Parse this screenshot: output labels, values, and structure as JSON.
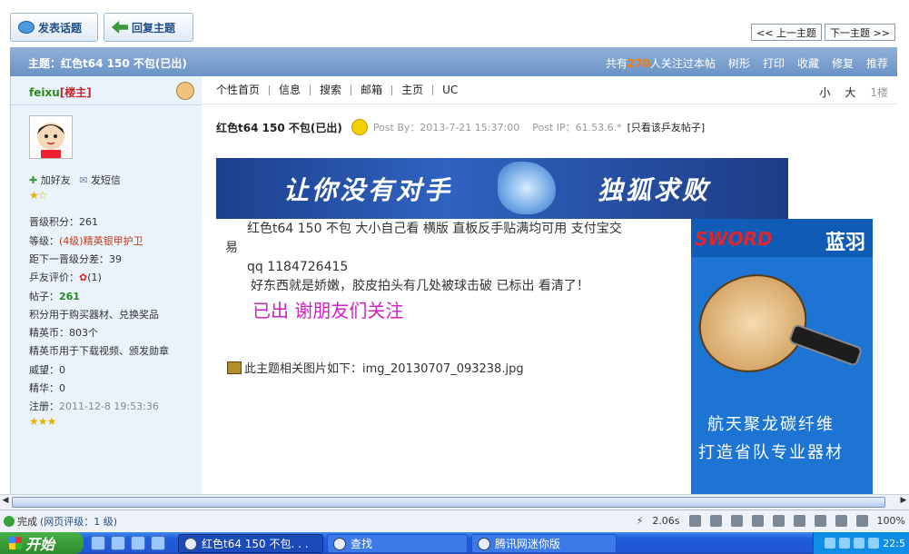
{
  "top_buttons": {
    "post_topic": "发表话题",
    "reply_topic": "回复主题",
    "prev_topic": "<< 上一主题",
    "next_topic": "下一主题 >>"
  },
  "header": {
    "title": "主题：红色t64 150 不包(已出)",
    "watch_prefix": "共有",
    "watch_count": "270",
    "watch_suffix": "人关注过本帖",
    "tools": [
      "树形",
      "打印",
      "收藏",
      "修复",
      "推荐"
    ]
  },
  "author": {
    "name": "feixu",
    "owner_tag": "[楼主]",
    "add_friend": "加好友",
    "send_message": "发短信",
    "rank_stars": "★☆",
    "points_label": "晋级积分：",
    "points_value": "261",
    "level_label": "等级：",
    "level_value": "(4级)精英银甲护卫",
    "next_label": "距下一晋级分差：",
    "next_value": "39",
    "rating_label": "乒友评价：",
    "rating_value": "(1)",
    "posts_label": "帖子：",
    "posts_value": "261",
    "posts_note": "积分用于购买器材、兑换奖品",
    "coins_label": "精英币：",
    "coins_value": "803个",
    "coins_note": "精英币用于下载视频、颁发勋章",
    "prestige_label": "威望：",
    "prestige_value": "0",
    "essence_label": "精华：",
    "essence_value": "0",
    "registered_label": "注册：",
    "registered_value": "2011-12-8 19:53:36",
    "bottom_stars": "★★★"
  },
  "post_menu": {
    "items": [
      "个性首页",
      "信息",
      "搜索",
      "邮箱",
      "主页",
      "UC"
    ],
    "font_small": "小",
    "font_large": "大",
    "floor": "1楼"
  },
  "post": {
    "title": "红色t64 150 不包(已出)",
    "post_by": "Post By：2013-7-21 15:37:00",
    "post_ip": "Post IP：61.53.6.*",
    "only_author": "[只看该乒友帖子]",
    "line1": "红色t64 150 不包  大小自己看  横版  直板反手贴满均可用  支付宝交",
    "line2": "易",
    "line3": "qq 1184726415",
    "line4": "好东西就是娇嫩，胶皮拍头有几处被球击破  已标出  看清了！",
    "sold": "已出  谢朋友们关注",
    "attach_text": "此主题相关图片如下：img_20130707_093238.jpg"
  },
  "banner": {
    "left_text": "让你没有对手",
    "right_text": "独狐求败"
  },
  "ad": {
    "brand_left": "SWORD",
    "brand_right": "蓝羽",
    "line1": "航天聚龙碳纤维",
    "line2": "打造省队专业器材"
  },
  "status": {
    "done": "完成",
    "grade": "(网页评级：1 级)",
    "speed": "2.06s",
    "zoom": "100%"
  },
  "taskbar": {
    "start": "开始",
    "task1": "红色t64 150 不包. . .",
    "task2": "查找",
    "task3": "腾讯网迷你版",
    "clock": "22:5"
  },
  "colors": {
    "header_blue": "#6a93c6",
    "accent_orange": "#ff7b00",
    "sold_magenta": "#d020c8",
    "left_panel": "#eaf2fb"
  }
}
